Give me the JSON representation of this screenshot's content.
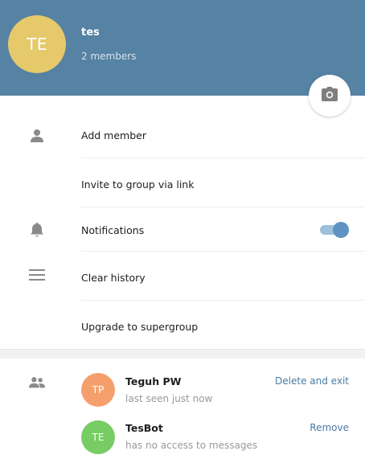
{
  "group": {
    "avatar_initials": "TE",
    "avatar_color": "#e6c96a",
    "name": "tes",
    "members_count": "2 members"
  },
  "header": {
    "background": "#5682a3",
    "camera_icon": "camera-icon"
  },
  "menu": {
    "add_member": "Add member",
    "invite_link": "Invite to group via link",
    "notifications": "Notifications",
    "notifications_enabled": true,
    "clear_history": "Clear history",
    "upgrade": "Upgrade to supergroup"
  },
  "members": [
    {
      "initials": "TP",
      "avatar_color": "#f5a06c",
      "name": "Teguh PW",
      "status": "last seen just now",
      "action": "Delete and exit"
    },
    {
      "initials": "TE",
      "avatar_color": "#77cc63",
      "name": "TesBot",
      "status": "has no access to messages",
      "action": "Remove"
    }
  ]
}
